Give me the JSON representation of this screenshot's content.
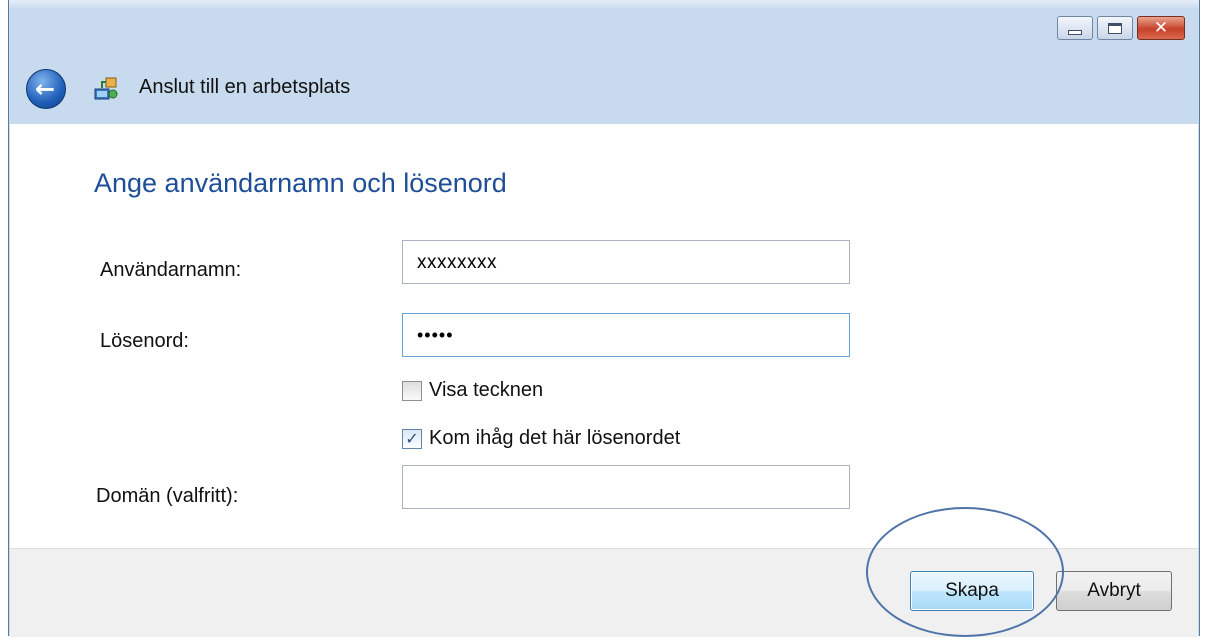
{
  "window": {
    "title": "Anslut till en arbetsplats",
    "controls": {
      "minimize_icon": "minimize-icon",
      "maximize_icon": "maximize-icon",
      "close_icon": "close-icon"
    }
  },
  "main": {
    "heading": "Ange användarnamn och lösenord",
    "username": {
      "label": "Användarnamn:",
      "value": "xxxxxxxx"
    },
    "password": {
      "label": "Lösenord:",
      "value": "•••••"
    },
    "show_characters": {
      "label": "Visa tecknen",
      "checked": false
    },
    "remember_password": {
      "label": "Kom ihåg det här lösenordet",
      "checked": true
    },
    "domain": {
      "label": "Domän (valfritt):",
      "value": ""
    }
  },
  "footer": {
    "create_label": "Skapa",
    "cancel_label": "Avbryt"
  },
  "colors": {
    "heading": "#1f4e99",
    "chrome": "#c7daee",
    "annotation": "#4f74a8"
  }
}
